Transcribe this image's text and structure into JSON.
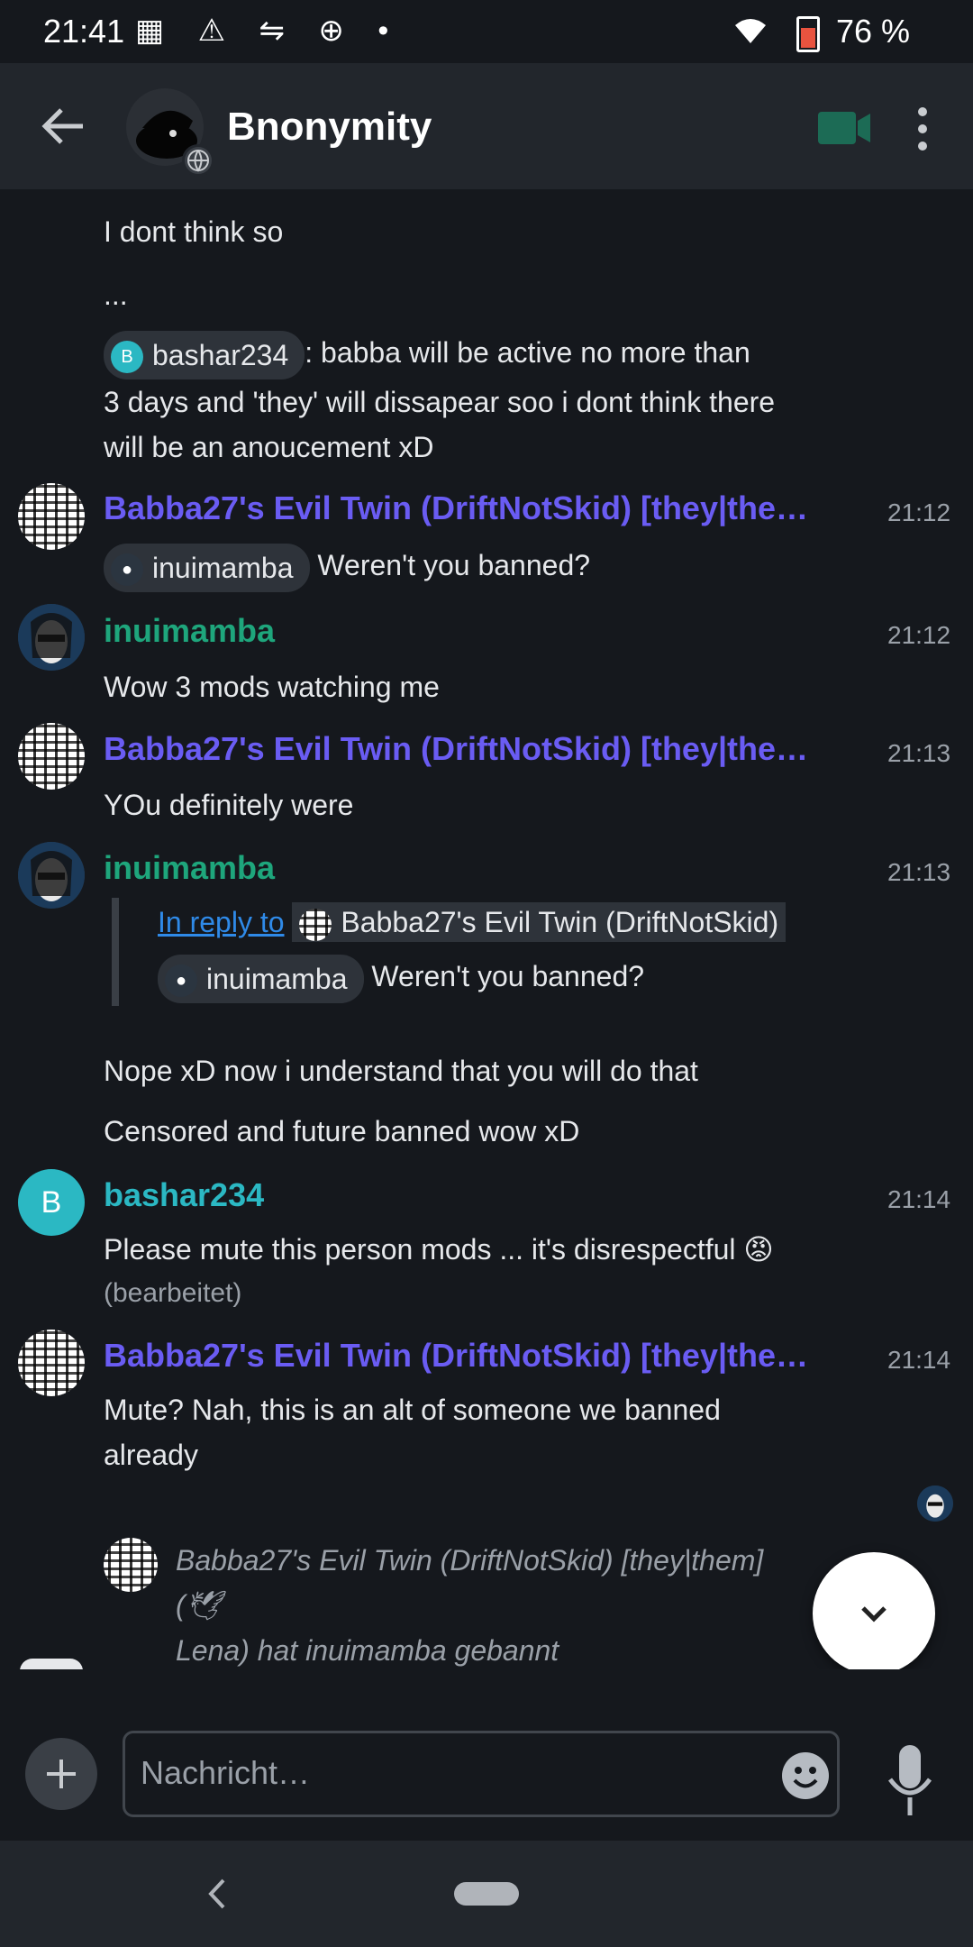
{
  "status": {
    "time": "21:41",
    "battery": "76 %"
  },
  "room": {
    "name": "Bnonymity"
  },
  "messages": {
    "m1": "I dont think so",
    "m2": "...",
    "m3_pill": "bashar234",
    "m3_pill_initial": "B",
    "m3_text_a": ": babba will be active no more than",
    "m3_text_b": "3 days and 'they' will dissapear soo i dont think there",
    "m3_text_c": "will be an anoucement xD",
    "g1_sender": "Babba27's Evil Twin (DriftNotSkid) [they|the…",
    "g1_time": "21:12",
    "g1_pill": "inuimamba",
    "g1_text": "Weren't you banned?",
    "g2_sender": "inuimamba",
    "g2_time": "21:12",
    "g2_text": "Wow 3 mods watching me",
    "g3_sender": "Babba27's Evil Twin (DriftNotSkid) [they|the…",
    "g3_time": "21:13",
    "g3_text": "YOu definitely were",
    "g4_sender": "inuimamba",
    "g4_time": "21:13",
    "g4_reply_link": "In reply to",
    "g4_reply_name": "Babba27's Evil Twin (DriftNotSkid)",
    "g4_reply_pill": "inuimamba",
    "g4_reply_text": "Weren't you banned?",
    "g4_text1": "Nope xD now i understand that you will do that",
    "g4_text2": "Censored and future banned wow xD",
    "g5_sender": "bashar234",
    "g5_initial": "B",
    "g5_time": "21:14",
    "g5_text": "Please mute this person mods ... it's disrespectful 😡",
    "g5_edited": "(bearbeitet)",
    "g6_sender": "Babba27's Evil Twin (DriftNotSkid) [they|the…",
    "g6_time": "21:14",
    "g6_text_a": "Mute? Nah, this is an alt of someone we banned",
    "g6_text_b": "already",
    "event_a": "Babba27's Evil Twin (DriftNotSkid) [they|them] (🕊",
    "event_b": "Lena) hat inuimamba gebannt"
  },
  "composer": {
    "placeholder": "Nachricht…"
  },
  "colors": {
    "purple": "#6a5cf3",
    "green": "#1ea67c",
    "teal": "#2bb8c3",
    "link": "#2f8ae8"
  },
  "icons": [
    "back-arrow-icon",
    "globe-icon",
    "video-call-icon",
    "more-vert-icon",
    "chevron-down-icon",
    "plus-icon",
    "emoji-icon",
    "mic-icon"
  ]
}
